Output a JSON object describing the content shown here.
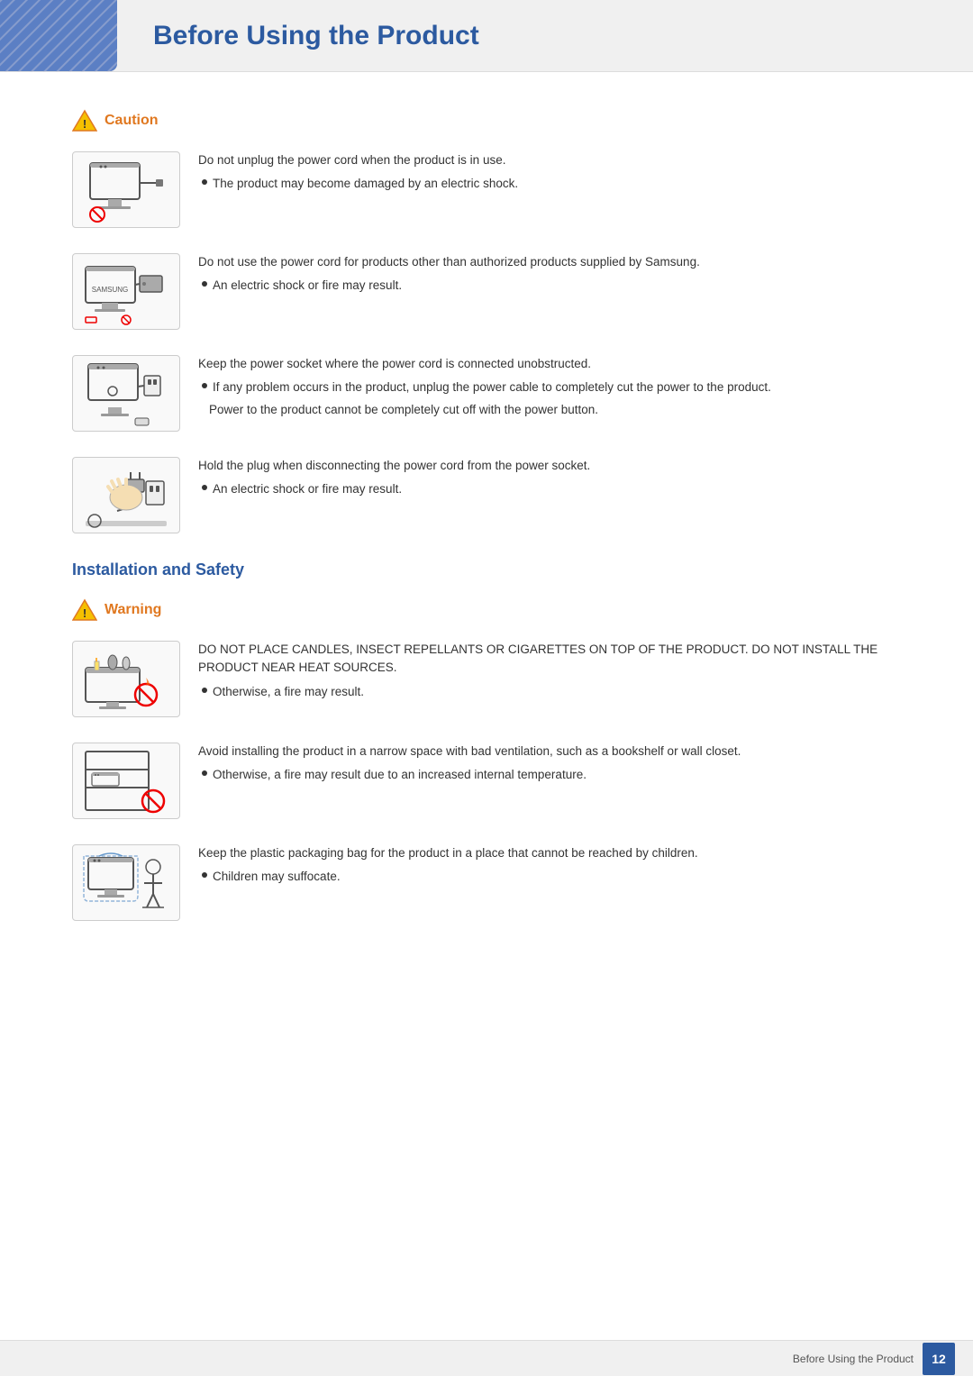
{
  "header": {
    "title": "Before Using the Product"
  },
  "caution_section": {
    "label": "Caution",
    "items": [
      {
        "id": "caution-1",
        "main_text": "Do not unplug the power cord when the product is in use.",
        "bullets": [
          "The product may become damaged by an electric shock."
        ],
        "sub_texts": []
      },
      {
        "id": "caution-2",
        "main_text": "Do not use the power cord for products other than authorized products supplied by Samsung.",
        "bullets": [
          "An electric shock or fire may result."
        ],
        "sub_texts": []
      },
      {
        "id": "caution-3",
        "main_text": "Keep the power socket where the power cord is connected unobstructed.",
        "bullets": [
          "If any problem occurs in the product, unplug the power cable to completely cut the power to the product."
        ],
        "sub_texts": [
          "Power to the product cannot be completely cut off with the power button."
        ]
      },
      {
        "id": "caution-4",
        "main_text": "Hold the plug when disconnecting the power cord from the power socket.",
        "bullets": [
          "An electric shock or fire may result."
        ],
        "sub_texts": []
      }
    ]
  },
  "installation_heading": "Installation and Safety",
  "warning_section": {
    "label": "Warning",
    "items": [
      {
        "id": "warning-1",
        "main_text": "DO NOT PLACE CANDLES, INSECT REPELLANTS OR CIGARETTES ON TOP OF THE PRODUCT. DO NOT INSTALL THE PRODUCT NEAR HEAT SOURCES.",
        "bullets": [
          "Otherwise, a fire may result."
        ],
        "sub_texts": []
      },
      {
        "id": "warning-2",
        "main_text": "Avoid installing the product in a narrow space with bad ventilation, such as a bookshelf or wall closet.",
        "bullets": [
          "Otherwise, a fire may result due to an increased internal temperature."
        ],
        "sub_texts": []
      },
      {
        "id": "warning-3",
        "main_text": "Keep the plastic packaging bag for the product in a place that cannot be reached by children.",
        "bullets": [
          "Children may suffocate."
        ],
        "sub_texts": []
      }
    ]
  },
  "footer": {
    "text": "Before Using the Product",
    "page": "12"
  }
}
